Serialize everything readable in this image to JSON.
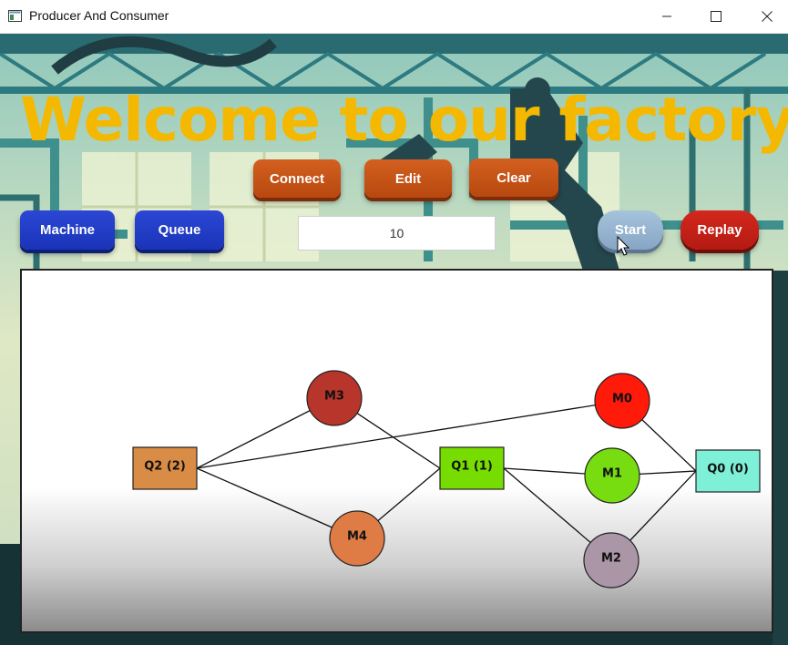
{
  "window": {
    "title": "Producer And Consumer"
  },
  "heading": "Welcome to our factory",
  "toolbar": {
    "connect_label": "Connect",
    "edit_label": "Edit",
    "clear_label": "Clear",
    "machine_label": "Machine",
    "queue_label": "Queue",
    "start_label": "Start",
    "replay_label": "Replay",
    "product_count_value": "10"
  },
  "colors": {
    "heading": "#f5b800",
    "orange_button": "#c4531a",
    "blue_button": "#2139c4",
    "red_button": "#c22118",
    "start_button": "#96b4d0"
  },
  "graph": {
    "nodes": [
      {
        "id": "Q2",
        "label": "Q2 (2)",
        "kind": "queue",
        "color": "#d98c45"
      },
      {
        "id": "M3",
        "label": "M3",
        "kind": "machine",
        "color": "#b7352b"
      },
      {
        "id": "M4",
        "label": "M4",
        "kind": "machine",
        "color": "#df7c46"
      },
      {
        "id": "Q1",
        "label": "Q1 (1)",
        "kind": "queue",
        "color": "#77dd00"
      },
      {
        "id": "M0",
        "label": "M0",
        "kind": "machine",
        "color": "#ff1a0a"
      },
      {
        "id": "M1",
        "label": "M1",
        "kind": "machine",
        "color": "#77dd11"
      },
      {
        "id": "M2",
        "label": "M2",
        "kind": "machine",
        "color": "#ab96a8"
      },
      {
        "id": "Q0",
        "label": "Q0 (0)",
        "kind": "queue",
        "color": "#7ff0d8"
      }
    ],
    "edges": [
      [
        "Q2",
        "M3"
      ],
      [
        "Q2",
        "M4"
      ],
      [
        "Q2",
        "M0"
      ],
      [
        "M3",
        "Q1"
      ],
      [
        "M4",
        "Q1"
      ],
      [
        "Q1",
        "M1"
      ],
      [
        "Q1",
        "M2"
      ],
      [
        "M0",
        "Q0"
      ],
      [
        "M1",
        "Q0"
      ],
      [
        "M2",
        "Q0"
      ]
    ]
  }
}
